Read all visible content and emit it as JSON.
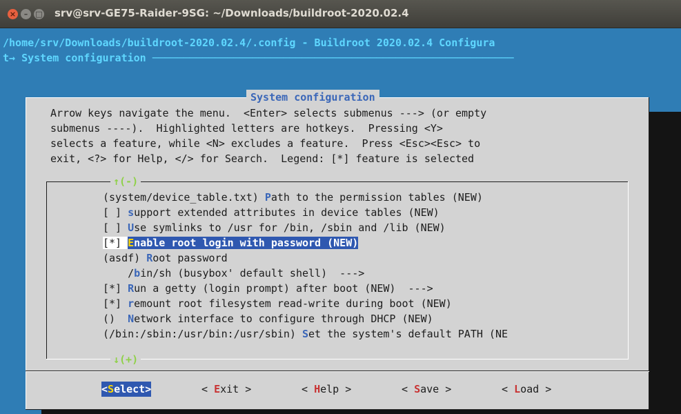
{
  "window": {
    "title": "srv@srv-GE75-Raider-9SG: ~/Downloads/buildroot-2020.02.4",
    "controls": {
      "close": "×",
      "minimize": "–",
      "maximize": "□"
    }
  },
  "terminal": {
    "header_line1": "/home/srv/Downloads/buildroot-2020.02.4/.config - Buildroot 2020.02.4 Configura",
    "header_line2": "t→ System configuration ──────────────────────────────────────────────────────────"
  },
  "dialog": {
    "title": "System configuration",
    "help_lines": [
      "Arrow keys navigate the menu.  <Enter> selects submenus ---> (or empty",
      "submenus ----).  Highlighted letters are hotkeys.  Pressing <Y>",
      "selects a feature, while <N> excludes a feature.  Press <Esc><Esc> to",
      "exit, <?> for Help, </> for Search.  Legend: [*] feature is selected"
    ],
    "scroll_up": "↑(-)",
    "scroll_down": "↓(+)",
    "items": [
      {
        "pre": "(system/device_table.txt) ",
        "hotkey": "P",
        "post": "ath to the permission tables (NEW)"
      },
      {
        "pre": "[ ] ",
        "hotkey": "s",
        "post": "upport extended attributes in device tables (NEW)"
      },
      {
        "pre": "[ ] ",
        "hotkey": "U",
        "post": "se symlinks to /usr for /bin, /sbin and /lib (NEW)"
      },
      {
        "pre": "[*] ",
        "hotkey": "E",
        "post": "nable root login with password (NEW)",
        "selected": true
      },
      {
        "pre": "(asdf) ",
        "hotkey": "R",
        "post": "oot password"
      },
      {
        "pre": "    /",
        "hotkey": "b",
        "post": "in/sh (busybox' default shell)  --->"
      },
      {
        "pre": "[*] ",
        "hotkey": "R",
        "post": "un a getty (login prompt) after boot (NEW)  --->"
      },
      {
        "pre": "[*] ",
        "hotkey": "r",
        "post": "emount root filesystem read-write during boot (NEW)"
      },
      {
        "pre": "()  ",
        "hotkey": "N",
        "post": "etwork interface to configure through DHCP (NEW)"
      },
      {
        "pre": "(/bin:/sbin:/usr/bin:/usr/sbin) ",
        "hotkey": "S",
        "post": "et the system's default PATH (NE"
      }
    ],
    "buttons": [
      {
        "open": "<",
        "hotkey": "S",
        "rest": "elect",
        "close": ">",
        "selected": true
      },
      {
        "open": "< ",
        "hotkey": "E",
        "rest": "xit",
        "close": " >"
      },
      {
        "open": "< ",
        "hotkey": "H",
        "rest": "elp",
        "close": " >"
      },
      {
        "open": "< ",
        "hotkey": "S",
        "rest": "ave",
        "close": " >"
      },
      {
        "open": "< ",
        "hotkey": "L",
        "rest": "oad",
        "close": " >"
      }
    ]
  },
  "colors": {
    "terminal_bg": "#2f7db5",
    "dialog_bg": "#d3d3d3",
    "hotkey": "#3a66b8",
    "selection": "#2f58b0",
    "button_hotkey": "#c83232"
  }
}
